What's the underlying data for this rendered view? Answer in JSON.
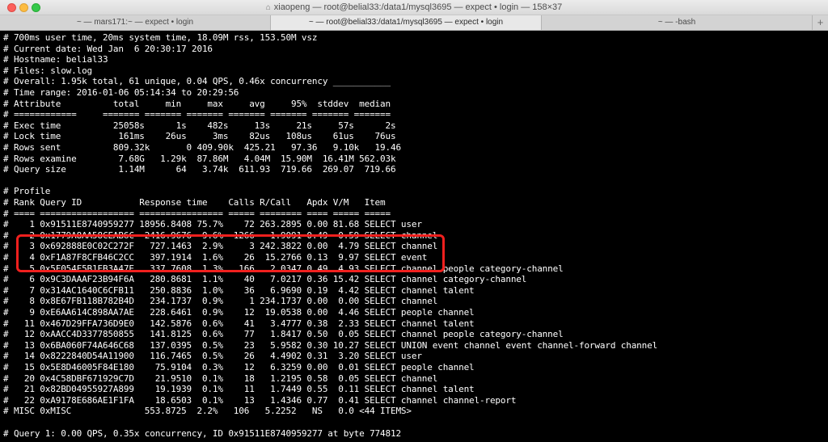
{
  "window": {
    "title": "xiaopeng — root@belial33:/data1/mysql3695 — expect • login — 158×37"
  },
  "tabs": [
    {
      "label": "~ — mars171:~ — expect • login"
    },
    {
      "label": "~ — root@belial33:/data1/mysql3695 — expect • login"
    },
    {
      "label": "~ — -bash"
    }
  ],
  "tab_add": "+",
  "colors": {
    "terminal_bg": "#000000",
    "terminal_fg": "#ffffff",
    "highlight": "#f0201e"
  },
  "terminal": {
    "lines": [
      "# 700ms user time, 20ms system time, 18.09M rss, 153.50M vsz",
      "# Current date: Wed Jan  6 20:30:17 2016",
      "# Hostname: belial33",
      "# Files: slow.log",
      "# Overall: 1.95k total, 61 unique, 0.04 QPS, 0.46x concurrency ___________",
      "# Time range: 2016-01-06 05:14:34 to 20:29:56",
      "# Attribute          total     min     max     avg     95%  stddev  median",
      "# ============     ======= ======= ======= ======= ======= ======= =======",
      "# Exec time          25058s      1s    482s     13s     21s     57s      2s",
      "# Lock time           161ms    26us     3ms    82us   108us    61us    76us",
      "# Rows sent          809.32k       0 409.90k  425.21   97.36   9.10k   19.46",
      "# Rows examine        7.68G   1.29k  87.86M   4.04M  15.90M  16.41M 562.03k",
      "# Query size          1.14M      64   3.74k  611.93  719.66  269.07  719.66",
      "",
      "# Profile",
      "# Rank Query ID           Response time    Calls R/Call   Apdx V/M   Item",
      "# ==== ================== ================ ===== ======== ==== ===== =====",
      "#    1 0x91511E8740959277 18956.8408 75.7%    72 263.2895 0.00 81.68 SELECT user",
      "#    2 0x1779A8AA58CEAB6C  2416.9676  9.6%  1266   1.9091 0.49  0.59 SELECT channel",
      "#    3 0x692888E0C02C272F   727.1463  2.9%     3 242.3822 0.00  4.79 SELECT channel",
      "#    4 0xF1A87F8CFB46C2CC   397.1914  1.6%    26  15.2766 0.13  9.97 SELECT event",
      "#    5 0x5F054F5B1EB3A47E   337.7608  1.3%   166   2.0347 0.49  4.93 SELECT channel people category-channel",
      "#    6 0x9C3DAAAF23B94F6A   280.8681  1.1%    40   7.0217 0.36 15.42 SELECT channel category-channel",
      "#    7 0x314AC1640C6CFB11   250.8836  1.0%    36   6.9690 0.19  4.42 SELECT channel talent",
      "#    8 0x8E67FB118B782B4D   234.1737  0.9%     1 234.1737 0.00  0.00 SELECT channel",
      "#    9 0xE6AA614C898AA7AE   228.6461  0.9%    12  19.0538 0.00  4.46 SELECT people channel",
      "#   11 0x467D29FFA736D9E0   142.5876  0.6%    41   3.4777 0.38  2.33 SELECT channel talent",
      "#   12 0xAACC4D3377850855   141.8125  0.6%    77   1.8417 0.50  0.05 SELECT channel people category-channel",
      "#   13 0x6BA060F74A646C68   137.0395  0.5%    23   5.9582 0.30 10.27 SELECT UNION event channel event channel-forward channel",
      "#   14 0x8222840D54A11900   116.7465  0.5%    26   4.4902 0.31  3.20 SELECT user",
      "#   15 0x5E8D46005F84E180    75.9104  0.3%    12   6.3259 0.00  0.01 SELECT people channel",
      "#   20 0x4C58DBF671929C7D    21.9510  0.1%    18   1.2195 0.58  0.05 SELECT channel",
      "#   21 0x82BD04955927A899    19.1939  0.1%    11   1.7449 0.55  0.11 SELECT channel talent",
      "#   22 0xA9178E686AE1F1FA    18.6503  0.1%    13   1.4346 0.77  0.41 SELECT channel channel-report",
      "# MISC 0xMISC              553.8725  2.2%   106   5.2252   NS   0.0 <44 ITEMS>",
      "",
      "# Query 1: 0.00 QPS, 0.35x concurrency, ID 0x91511E8740959277 at byte 774812"
    ]
  }
}
